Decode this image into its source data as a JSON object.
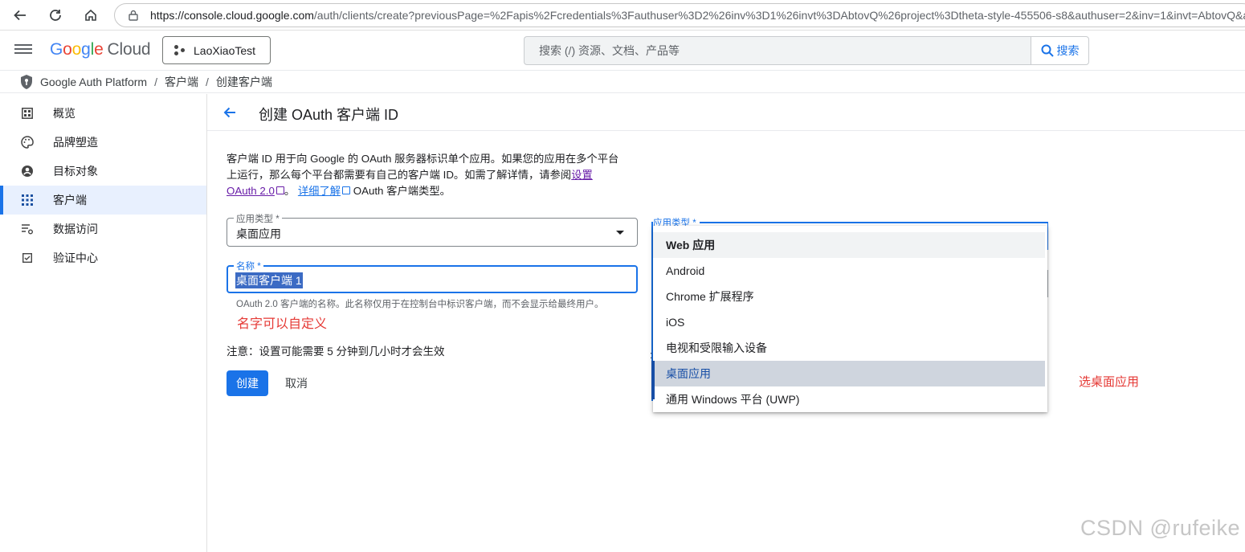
{
  "browser": {
    "url_host": "https://console.cloud.google.com",
    "url_rest": "/auth/clients/create?previousPage=%2Fapis%2Fcredentials%3Fauthuser%3D2%26inv%3D1%26invt%3DAbtovQ%26project%3Dtheta-style-455506-s8&authuser=2&inv=1&invt=AbtovQ&a"
  },
  "header": {
    "logo_google": "Google",
    "logo_cloud": "Cloud",
    "project": "LaoXiaoTest",
    "search_placeholder": "搜索 (/) 资源、文档、产品等",
    "search_button": "搜索"
  },
  "breadcrumb": [
    "Google Auth Platform",
    "/",
    "客户端",
    "/",
    "创建客户端"
  ],
  "sidebar": {
    "items": [
      {
        "label": "概览",
        "icon": "dashboard-icon"
      },
      {
        "label": "品牌塑造",
        "icon": "palette-icon"
      },
      {
        "label": "目标对象",
        "icon": "account-circle-icon"
      },
      {
        "label": "客户端",
        "icon": "apps-grid-icon",
        "active": true
      },
      {
        "label": "数据访问",
        "icon": "data-settings-icon"
      },
      {
        "label": "验证中心",
        "icon": "verify-checkbox-icon"
      }
    ]
  },
  "main": {
    "title": "创建 OAuth 客户端 ID",
    "desc_line1": "客户端 ID 用于向 Google 的 OAuth 服务器标识单个应用。如果您的应用在多个平台",
    "desc_line2_a": "上运行，那么每个平台都需要有自己的客户端 ID。如需了解详情，请参阅",
    "desc_link1_a": "设置",
    "desc_link1_b": "OAuth 2.0",
    "desc_mid": "。",
    "desc_link2": "详细了解",
    "desc_tail": " OAuth 客户端类型。",
    "app_type_label": "应用类型 *",
    "app_type_value": "桌面应用",
    "name_label": "名称 *",
    "name_value": "桌面客户端 1",
    "name_hint": "OAuth 2.0 客户端的名称。此名称仅用于在控制台中标识客户端，而不会显示给最终用户。",
    "annotation_name": "名字可以自定义",
    "notice": "注意：设置可能需要 5 分钟到几小时才会生效",
    "create_button": "创建",
    "cancel_button": "取消"
  },
  "dropdown": {
    "label": "应用类型 *",
    "options": [
      "Web 应用",
      "Android",
      "Chrome 扩展程序",
      "iOS",
      "电视和受限输入设备",
      "桌面应用",
      "通用 Windows 平台 (UWP)"
    ],
    "hovered": "Web 应用",
    "selected": "桌面应用"
  },
  "annotation_select": "选桌面应用",
  "watermark": "CSDN @rufeike",
  "colors": {
    "accent": "#1a73e8",
    "annotation": "#e53935",
    "selected_bg": "#cfd5de"
  }
}
